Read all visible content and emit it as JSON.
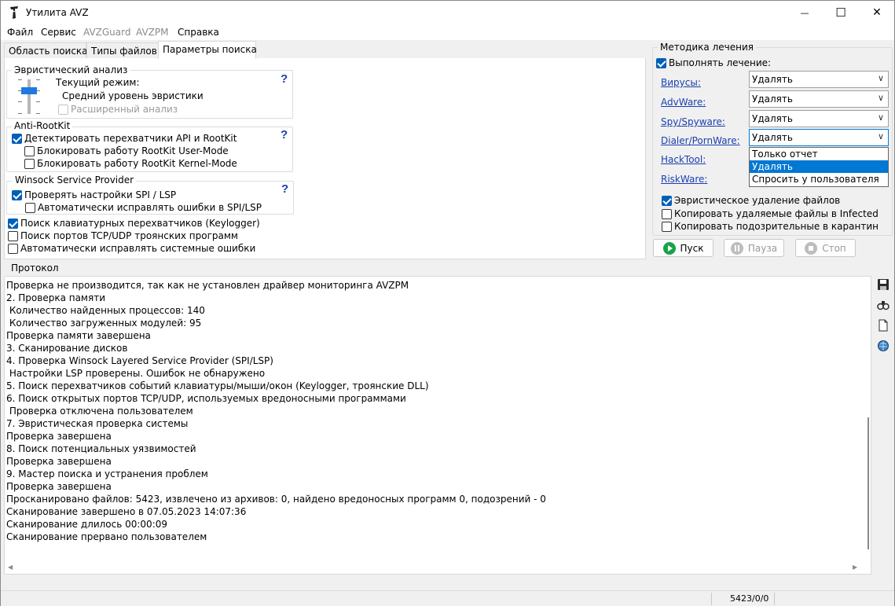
{
  "window": {
    "title": "Утилита AVZ",
    "controls": {
      "minimize": "—",
      "maximize": "☐",
      "close": "✕"
    }
  },
  "menu": [
    {
      "label": "Файл",
      "enabled": true
    },
    {
      "label": "Сервис",
      "enabled": true
    },
    {
      "label": "AVZGuard",
      "enabled": false
    },
    {
      "label": "AVZPM",
      "enabled": false
    },
    {
      "label": "Справка",
      "enabled": true
    }
  ],
  "tabs": [
    {
      "label": "Область поиска",
      "active": false
    },
    {
      "label": "Типы файлов",
      "active": false
    },
    {
      "label": "Параметры поиска",
      "active": true
    }
  ],
  "heuristic": {
    "title": "Эвристический анализ",
    "mode_label": "Текущий режим:",
    "mode_value": "Средний уровень эвристики",
    "extended": {
      "label": "Расширенный анализ",
      "checked": false,
      "enabled": false
    },
    "help": "?"
  },
  "antirootkit": {
    "title": "Anti-RootKit",
    "help": "?",
    "options": [
      {
        "label": "Детектировать перехватчики API и RootKit",
        "checked": true
      },
      {
        "label": "Блокировать работу RootKit User-Mode",
        "checked": false
      },
      {
        "label": "Блокировать работу RootKit Kernel-Mode",
        "checked": false
      }
    ]
  },
  "winsock": {
    "title": "Winsock  Service Provider",
    "help": "?",
    "options": [
      {
        "label": "Проверять настройки SPI / LSP",
        "checked": true
      },
      {
        "label": "Автоматически исправлять ошибки в SPI/LSP",
        "checked": false
      }
    ]
  },
  "extra_options": [
    {
      "label": "Поиск клавиатурных перехватчиков (Keylogger)",
      "checked": true
    },
    {
      "label": "Поиск портов TCP/UDP троянских программ",
      "checked": false
    },
    {
      "label": "Автоматически исправлять системные ошибки",
      "checked": false
    }
  ],
  "treatment": {
    "title": "Методика лечения",
    "perform": {
      "label": "Выполнять лечение:",
      "checked": true
    },
    "rows": [
      {
        "label": "Вирусы:",
        "value": "Удалять"
      },
      {
        "label": "AdvWare:",
        "value": "Удалять"
      },
      {
        "label": "Spy/Spyware:",
        "value": "Удалять"
      },
      {
        "label": "Dialer/PornWare:",
        "value": "Удалять"
      },
      {
        "label": "HackTool:",
        "value": ""
      },
      {
        "label": "RiskWare:",
        "value": ""
      }
    ],
    "dropdown_options": [
      "Только отчет",
      "Удалять",
      "Спросить у пользователя"
    ],
    "dropdown_selected": "Удалять",
    "options": [
      {
        "label": "Эвристическое удаление файлов",
        "checked": true
      },
      {
        "label": "Копировать удаляемые файлы в  Infected",
        "checked": false
      },
      {
        "label": "Копировать подозрительные в  карантин",
        "checked": false
      }
    ]
  },
  "buttons": {
    "start": "Пуск",
    "pause": "Пауза",
    "stop": "Стоп"
  },
  "protocol": {
    "title": "Протокол",
    "lines": [
      "Проверка не производится, так как не установлен драйвер мониторинга AVZPM",
      "2. Проверка памяти",
      " Количество найденных процессов: 140",
      " Количество загруженных модулей: 95",
      "Проверка памяти завершена",
      "3. Сканирование дисков",
      "4. Проверка Winsock Layered Service Provider (SPI/LSP)",
      " Настройки LSP проверены. Ошибок не обнаружено",
      "5. Поиск перехватчиков событий клавиатуры/мыши/окон (Keylogger, троянские DLL)",
      "6. Поиск открытых портов TCP/UDP, используемых вредоносными программами",
      " Проверка отключена пользователем",
      "7. Эвристическая проверка системы",
      "Проверка завершена",
      "8. Поиск потенциальных уязвимостей",
      "Проверка завершена",
      "9. Мастер поиска и устранения проблем",
      "Проверка завершена",
      "Просканировано файлов: 5423, извлечено из архивов: 0, найдено вредоносных программ 0, подозрений - 0",
      "Сканирование завершено в 07.05.2023 14:07:36",
      "Сканирование длилось 00:00:09",
      "Сканирование прервано пользователем"
    ]
  },
  "status": {
    "counter": "5423/0/0"
  },
  "colors": {
    "accent": "#005fb8",
    "selection": "#0078d4",
    "link": "#1a3fb0",
    "start_icon": "#16a34a"
  }
}
